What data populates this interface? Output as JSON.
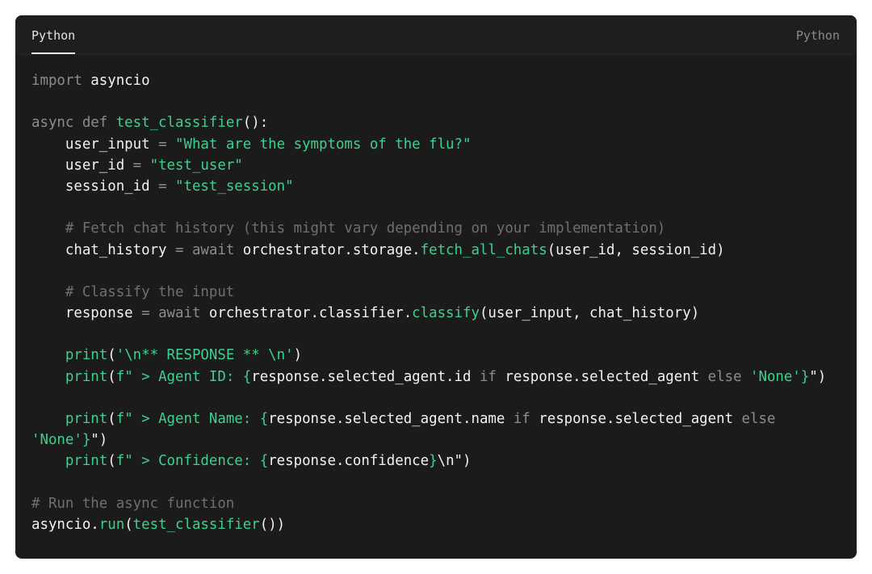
{
  "header": {
    "tab_label": "Python",
    "language_label": "Python"
  },
  "code_lines": [
    [
      [
        "keyword",
        "import "
      ],
      [
        "plain",
        "asyncio"
      ]
    ],
    [],
    [
      [
        "keyword",
        "async def "
      ],
      [
        "func",
        "test_classifier"
      ],
      [
        "plain",
        "():"
      ]
    ],
    [
      [
        "plain",
        "    user_input "
      ],
      [
        "keyword",
        "= "
      ],
      [
        "string",
        "\"What are the symptoms of the flu?\""
      ]
    ],
    [
      [
        "plain",
        "    user_id "
      ],
      [
        "keyword",
        "= "
      ],
      [
        "string",
        "\"test_user\""
      ]
    ],
    [
      [
        "plain",
        "    session_id "
      ],
      [
        "keyword",
        "= "
      ],
      [
        "string",
        "\"test_session\""
      ]
    ],
    [],
    [
      [
        "comment",
        "    # Fetch chat history (this might vary depending on your implementation)"
      ]
    ],
    [
      [
        "plain",
        "    chat_history "
      ],
      [
        "keyword",
        "= await "
      ],
      [
        "plain",
        "orchestrator.storage."
      ],
      [
        "func",
        "fetch_all_chats"
      ],
      [
        "plain",
        "(user_id, session_id)"
      ]
    ],
    [],
    [
      [
        "comment",
        "    # Classify the input"
      ]
    ],
    [
      [
        "plain",
        "    response "
      ],
      [
        "keyword",
        "= await "
      ],
      [
        "plain",
        "orchestrator.classifier."
      ],
      [
        "func",
        "classify"
      ],
      [
        "plain",
        "(user_input, chat_history)"
      ]
    ],
    [],
    [
      [
        "func",
        "    print"
      ],
      [
        "plain",
        "("
      ],
      [
        "string",
        "'\\n** RESPONSE ** \\n'"
      ],
      [
        "plain",
        ")"
      ]
    ],
    [
      [
        "func",
        "    print"
      ],
      [
        "plain",
        "("
      ],
      [
        "string",
        "f\" > Agent ID: {"
      ],
      [
        "plain",
        "response.selected_agent.id "
      ],
      [
        "keyword",
        "if "
      ],
      [
        "plain",
        "response.selected_agent "
      ],
      [
        "keyword",
        "else "
      ],
      [
        "string",
        "'None'}"
      ],
      [
        "plain",
        "\")"
      ]
    ],
    [],
    [
      [
        "func",
        "    print"
      ],
      [
        "plain",
        "("
      ],
      [
        "string",
        "f\" > Agent Name: {"
      ],
      [
        "plain",
        "response.selected_agent.name "
      ],
      [
        "keyword",
        "if "
      ],
      [
        "plain",
        "response.selected_agent "
      ],
      [
        "keyword",
        "else"
      ]
    ],
    [
      [
        "string",
        "'None'}"
      ],
      [
        "plain",
        "\")"
      ]
    ],
    [
      [
        "func",
        "    print"
      ],
      [
        "plain",
        "("
      ],
      [
        "string",
        "f\" > Confidence: {"
      ],
      [
        "plain",
        "response.confidence"
      ],
      [
        "string",
        "}"
      ],
      [
        "plain",
        "\\n\")"
      ]
    ],
    [],
    [
      [
        "comment",
        "# Run the async function"
      ]
    ],
    [
      [
        "plain",
        "asyncio."
      ],
      [
        "func",
        "run"
      ],
      [
        "plain",
        "("
      ],
      [
        "func",
        "test_classifier"
      ],
      [
        "plain",
        "())"
      ]
    ]
  ]
}
